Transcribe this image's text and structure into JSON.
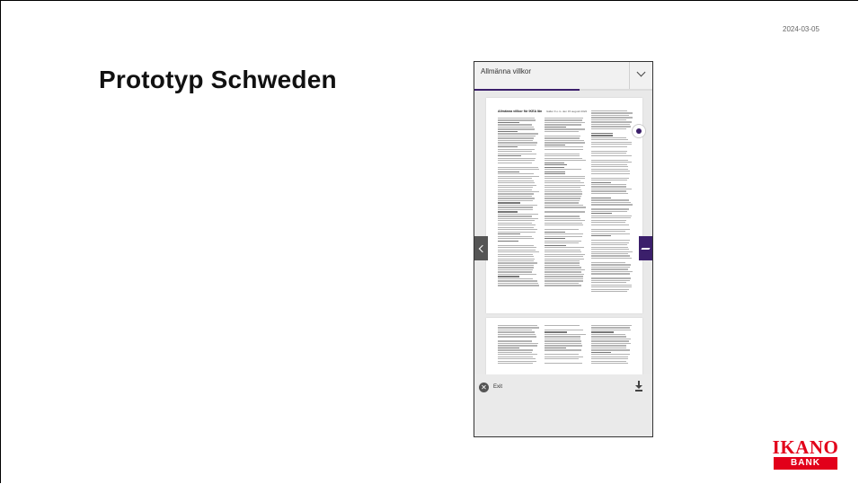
{
  "slide": {
    "date": "2024-03-05",
    "title": "Prototyp Schweden"
  },
  "app": {
    "header_title": "Allmänna villkor",
    "progress_fraction": 0.59,
    "document": {
      "heading": "Allmänna villkor för IKEA lån",
      "subheading": "Gäller fr.o.m. den 15 augusti 2022"
    },
    "zoom": {
      "plus": "+",
      "minus": "−"
    },
    "footer": {
      "exit_label": "Exit"
    }
  },
  "logo": {
    "main": "IKANO",
    "sub": "BANK"
  },
  "colors": {
    "brand_purple": "#3b1f6b",
    "ikano_red": "#e2001a"
  },
  "icons": [
    "chevron-down-icon",
    "globe-icon",
    "chevron-left-icon",
    "brand-mark-icon",
    "close-circle-icon",
    "download-icon"
  ]
}
